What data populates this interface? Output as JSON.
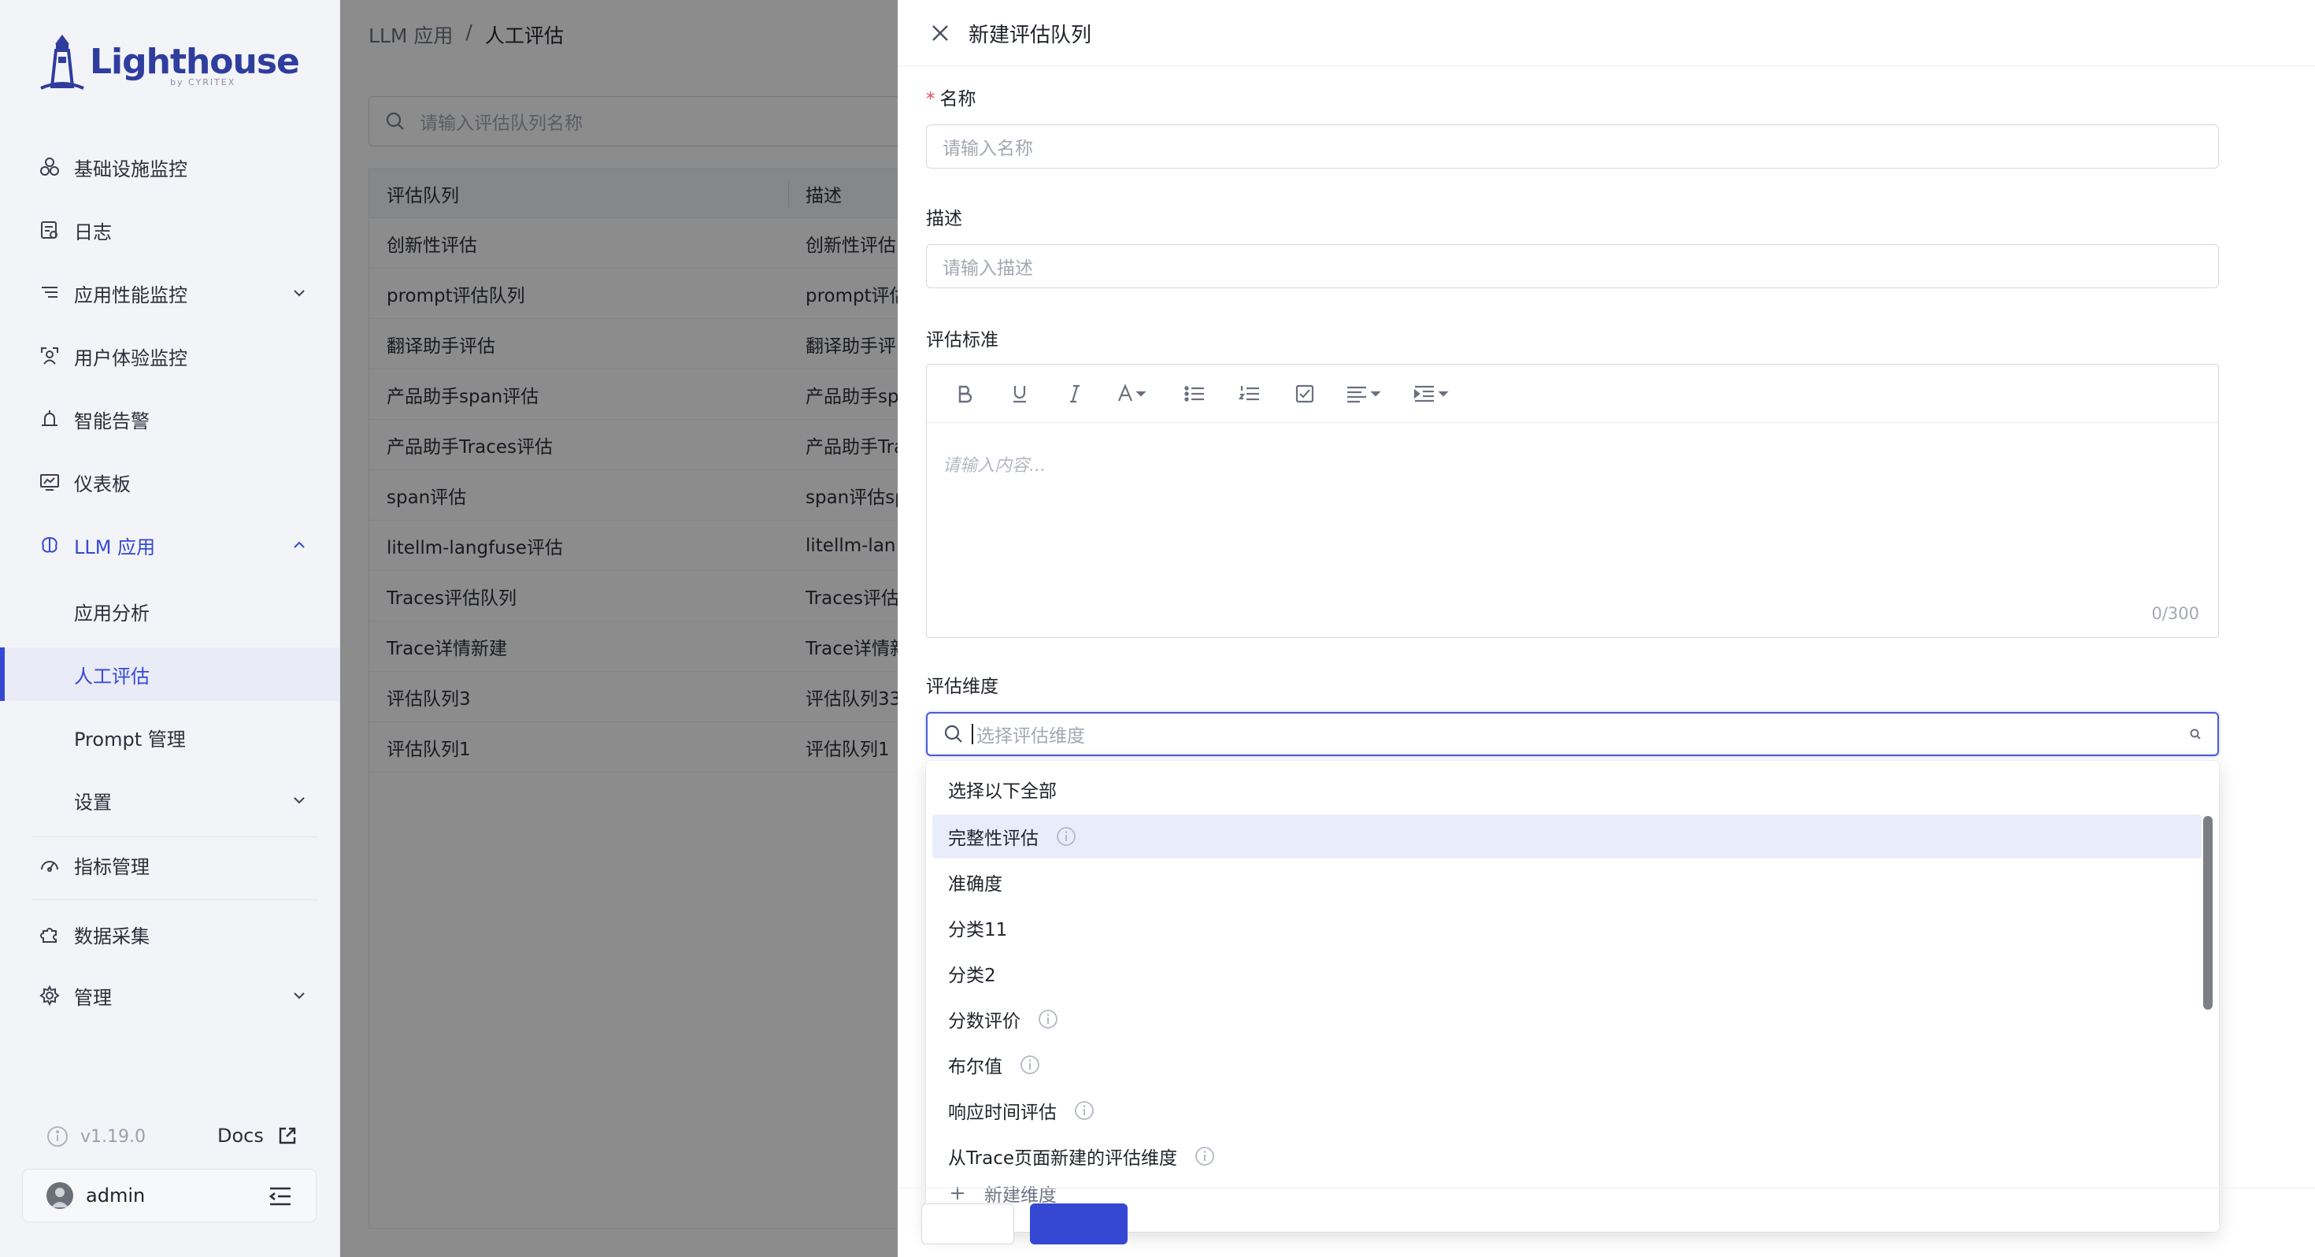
{
  "app": {
    "logo_text_a": "Light",
    "logo_text_b": "house",
    "logo_sub": "by CYRITEX",
    "version": "v1.19.0",
    "docs_label": "Docs",
    "username": "admin"
  },
  "sidebar": {
    "items": [
      {
        "label": "基础设施监控",
        "icon": "cluster-icon"
      },
      {
        "label": "日志",
        "icon": "log-icon"
      },
      {
        "label": "应用性能监控",
        "icon": "apm-icon"
      },
      {
        "label": "用户体验监控",
        "icon": "user-monitor-icon"
      },
      {
        "label": "智能告警",
        "icon": "alarm-icon"
      },
      {
        "label": "仪表板",
        "icon": "dashboard-icon"
      },
      {
        "label": "LLM 应用",
        "icon": "llm-brain-icon"
      },
      {
        "label": "应用分析"
      },
      {
        "label": "人工评估"
      },
      {
        "label": "Prompt 管理"
      },
      {
        "label": "设置"
      },
      {
        "label": "指标管理",
        "icon": "gauge-icon"
      },
      {
        "label": "数据采集",
        "icon": "puzzle-icon"
      },
      {
        "label": "管理",
        "icon": "gear-icon"
      }
    ]
  },
  "breadcrumb": {
    "parent": "LLM 应用",
    "sep": "/",
    "current": "人工评估"
  },
  "list": {
    "search_placeholder": "请输入评估队列名称",
    "columns": [
      "评估队列",
      "描述"
    ],
    "rows": [
      [
        "创新性评估",
        "创新性评估"
      ],
      [
        "prompt评估队列",
        "prompt评估"
      ],
      [
        "翻译助手评估",
        "翻译助手评"
      ],
      [
        "产品助手span评估",
        "产品助手sp"
      ],
      [
        "产品助手Traces评估",
        "产品助手Tra"
      ],
      [
        "span评估",
        "span评估sp"
      ],
      [
        "litellm-langfuse评估",
        "litellm-lan"
      ],
      [
        "Traces评估队列",
        "Traces评估"
      ],
      [
        "Trace详情新建",
        "Trace详情新"
      ],
      [
        "评估队列3",
        "评估队列33"
      ],
      [
        "评估队列1",
        "评估队列1"
      ]
    ]
  },
  "drawer": {
    "title": "新建评估队列",
    "name_label": "名称",
    "required_mark": "*",
    "name_placeholder": "请输入名称",
    "desc_label": "描述",
    "desc_placeholder": "请输入描述",
    "criteria_label": "评估标准",
    "editor_placeholder": "请输入内容...",
    "counter": "0/300",
    "dimension_label": "评估维度",
    "dimension_placeholder": "选择评估维度",
    "dropdown": {
      "select_all": "选择以下全部",
      "options": [
        {
          "label": "完整性评估",
          "info": true
        },
        {
          "label": "准确度",
          "info": false
        },
        {
          "label": "分类11",
          "info": false
        },
        {
          "label": "分类2",
          "info": false
        },
        {
          "label": "分数评价",
          "info": true
        },
        {
          "label": "布尔值",
          "info": true
        },
        {
          "label": "响应时间评估",
          "info": true
        },
        {
          "label": "从Trace页面新建的评估维度",
          "info": true
        }
      ],
      "add_label": "新建维度"
    }
  },
  "colors": {
    "accent": "#3548d4",
    "highlight": "#e9edfb"
  }
}
